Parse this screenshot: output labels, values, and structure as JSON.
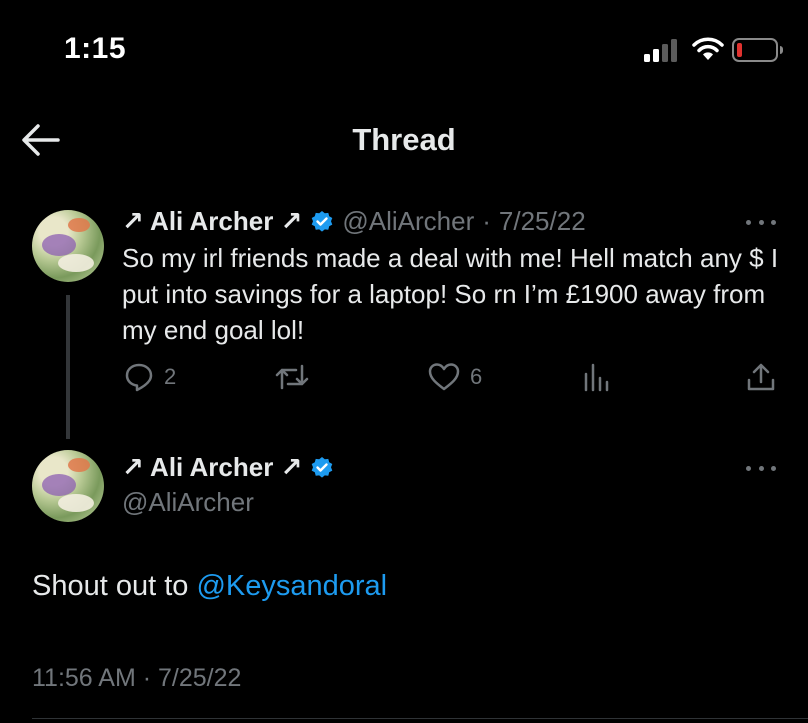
{
  "status_bar": {
    "time": "1:15"
  },
  "nav": {
    "title": "Thread"
  },
  "reply_tweet": {
    "display_name": "↗ Ali Archer ↗",
    "handle": "@AliArcher",
    "separator": "·",
    "date": "7/25/22",
    "text": "So my irl friends made a deal with me! Hell match any $ I put into savings for a laptop! So rn I’m £1900 away from my end goal lol!",
    "replies": "2",
    "likes": "6"
  },
  "main_tweet": {
    "display_name": "↗ Ali Archer ↗",
    "handle": "@AliArcher",
    "text_prefix": "Shout out to ",
    "mention": "@Keysandoral",
    "timestamp": "11:56 AM · 7/25/22"
  },
  "colors": {
    "accent": "#1d9bf0",
    "muted": "#71767b",
    "text": "#e7e9ea",
    "background": "#000000",
    "battery_low": "#e0322f"
  }
}
